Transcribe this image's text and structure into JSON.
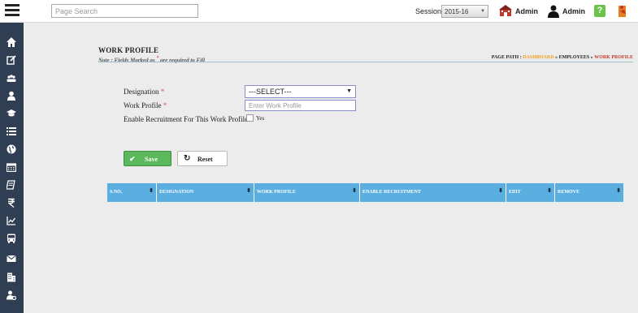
{
  "topbar": {
    "search_placeholder": "Page Search",
    "session_label": "Session",
    "session_value": "2015-16",
    "admin_links": [
      "Admin",
      "Admin"
    ]
  },
  "sidebar": {
    "icons": [
      "home-icon",
      "edit-icon",
      "users-icon",
      "user-icon",
      "graduation-cap-icon",
      "list-icon",
      "globe-icon",
      "calendar-icon",
      "book-icon",
      "rupee-icon",
      "chart-icon",
      "bus-icon",
      "mail-icon",
      "building-icon",
      "user-settings-icon"
    ]
  },
  "page": {
    "title": "WORK PROFILE",
    "note_prefix": "Note : Fields Marked as",
    "note_star": "*",
    "note_suffix": "are required to Fill",
    "path_label": "PAGE PATH :",
    "path_dashboard": "DASHBOARD",
    "path_sep1": "»",
    "path_employees": "EMPLOYEES",
    "path_sep2": "»",
    "path_current": "WORK PROFILE"
  },
  "form": {
    "designation_label": "Designation",
    "designation_value": "---SELECT---",
    "work_profile_label": "Work Profile",
    "work_profile_placeholder": "Enter Work Profile",
    "required_mark": "*",
    "enable_label": "Enable Recruitment For This Work Profile",
    "yes_label": "Yes",
    "save_label": "Save",
    "reset_label": "Reset"
  },
  "table": {
    "columns": [
      "S.NO.",
      "DESIGNATION",
      "WORK PROFILE",
      "ENABLE RECRUITMENT",
      "EDIT",
      "REMOVE"
    ]
  },
  "colors": {
    "sidebar": "#2f3e52",
    "table_header": "#5aaee0",
    "save": "#5cb85c",
    "required": "#d9534f"
  }
}
